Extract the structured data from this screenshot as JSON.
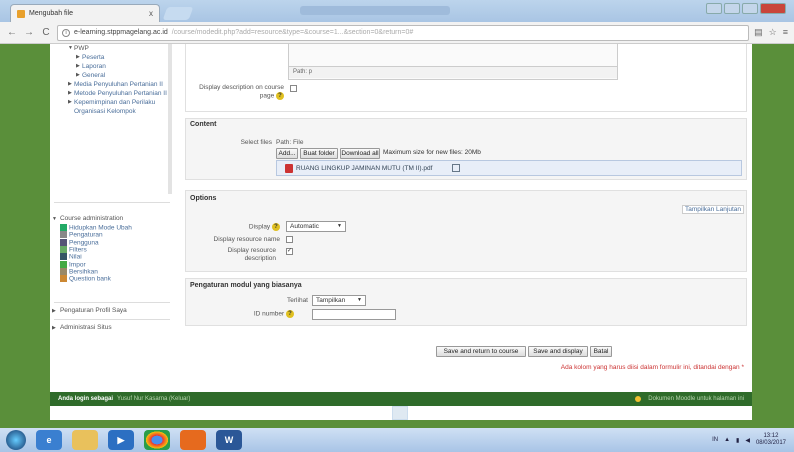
{
  "browser": {
    "tab_title": "Mengubah file",
    "tab_close": "x",
    "url_host": "e-learning.stppmagelang.ac.id",
    "url_rest": "/course/modedit.php?add=resource&type=&course=1...&section=0&return=0#",
    "nav_back": "←",
    "nav_forward": "→",
    "nav_reload": "C"
  },
  "sidebar": {
    "tree": [
      {
        "label": "PWP",
        "indent": 2,
        "arrow": "▼"
      },
      {
        "label": "Peserta",
        "indent": 3,
        "arrow": "▶"
      },
      {
        "label": "Laporan",
        "indent": 3,
        "arrow": "▶"
      },
      {
        "label": "General",
        "indent": 3,
        "arrow": "▶"
      },
      {
        "label": "Media Penyuluhan Pertanian II",
        "indent": 2,
        "arrow": "▶"
      },
      {
        "label": "Metode Penyuluhan Pertanian II",
        "indent": 2,
        "arrow": "▶"
      },
      {
        "label": "Kepemimpinan dan Perilaku Organisasi Kelompok",
        "indent": 2,
        "arrow": "▶"
      }
    ],
    "admin_title": "Course administration",
    "admin_items": [
      {
        "label": "Hidupkan Mode Ubah",
        "icon": "pencil-icon"
      },
      {
        "label": "Pengaturan",
        "icon": "settings-icon"
      },
      {
        "label": "Pengguna",
        "icon": "users-icon"
      },
      {
        "label": "Filters",
        "icon": "filter-icon"
      },
      {
        "label": "Nilai",
        "icon": "grades-icon"
      },
      {
        "label": "Impor",
        "icon": "import-icon"
      },
      {
        "label": "Bersihkan",
        "icon": "reset-icon"
      },
      {
        "label": "Question bank",
        "icon": "question-bank-icon"
      }
    ],
    "profile_settings": "Pengaturan Profil Saya",
    "site_admin": "Administrasi Situs"
  },
  "form": {
    "path_label": "Path: p",
    "display_desc_label": "Display description on course page",
    "content_legend": "Content",
    "select_files_label": "Select files",
    "select_files_path": "Path: File",
    "btn_add": "Add...",
    "btn_new_folder": "Buat folder",
    "btn_download_all": "Download all",
    "max_size": "Maximum size for new files: 20Mb",
    "file_name": "RUANG LINGKUP JAMINAN MUTU (TM II).pdf",
    "options_legend": "Options",
    "show_more": "Tampilkan Lanjutan",
    "display_label": "Display",
    "display_value": "Automatic",
    "display_resource_name_label": "Display resource name",
    "display_resource_desc_label": "Display resource description",
    "common_legend": "Pengaturan modul yang biasanya",
    "visible_label": "Terlihat",
    "visible_value": "Tampilkan",
    "id_number_label": "ID number",
    "btn_save_return": "Save and return to course",
    "btn_save_display": "Save and display",
    "btn_cancel": "Batal",
    "required_note": "Ada kolom yang harus diisi dalam formulir ini, ditandai dengan"
  },
  "footer": {
    "logged_in": "Anda login sebagai",
    "user": "Yusuf Nur Kasarna (Keluar)",
    "moodle_docs": "Dokumen Moodle untuk halaman ini"
  },
  "taskbar": {
    "time": "13:12",
    "date": "08/03/2017",
    "lang": "IN",
    "apps": [
      "start-orb",
      "internet-explorer",
      "file-explorer",
      "media-player",
      "chrome",
      "firefox",
      "word"
    ]
  },
  "colors": {
    "page_bg_green": "#5a8f3a",
    "footer_green": "#2f6b2a",
    "link_blue": "#4a6e9a",
    "required_red": "#c33"
  }
}
